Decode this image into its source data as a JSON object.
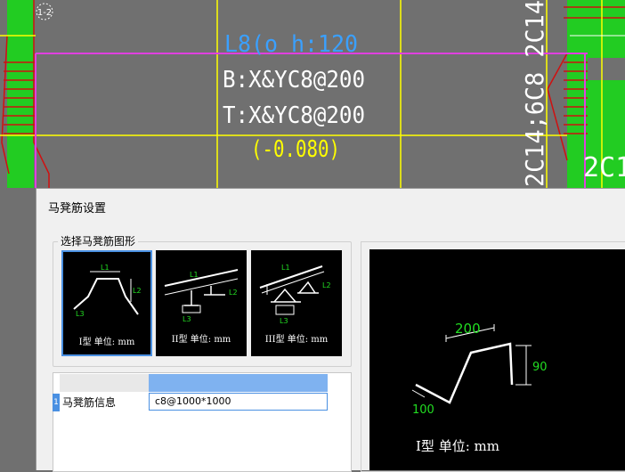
{
  "cad": {
    "lines": [
      "L8(o h:120",
      "B:X&YC8@200",
      "T:X&YC8@200",
      "(-0.080)"
    ],
    "rebar_vertical": "2C14;6C8 2C14",
    "rebar_corner": "2C1",
    "marker": "1-2",
    "colors": {
      "background": "#707070",
      "green": "#22cc22",
      "magenta": "#e040e0",
      "yellow": "#ffff00",
      "red": "#d01010",
      "text": "#ffffff"
    }
  },
  "dialog": {
    "title": "马凳筋设置",
    "shape_group_label": "选择马凳筋图形",
    "shapes": [
      {
        "caption": "I型 单位: mm",
        "selected": true,
        "labels": [
          "L1",
          "L2",
          "L3"
        ]
      },
      {
        "caption": "II型 单位: mm",
        "selected": false,
        "labels": [
          "L1",
          "L2",
          "L3"
        ]
      },
      {
        "caption": "III型 单位: mm",
        "selected": false,
        "labels": [
          "L1",
          "L2",
          "L3"
        ]
      }
    ],
    "table": {
      "row_number": "1",
      "label": "马凳筋信息",
      "value": "c8@1000*1000"
    },
    "preview": {
      "caption": "I型  单位: mm",
      "dims": {
        "top": "200",
        "right": "90",
        "left": "100"
      }
    }
  }
}
